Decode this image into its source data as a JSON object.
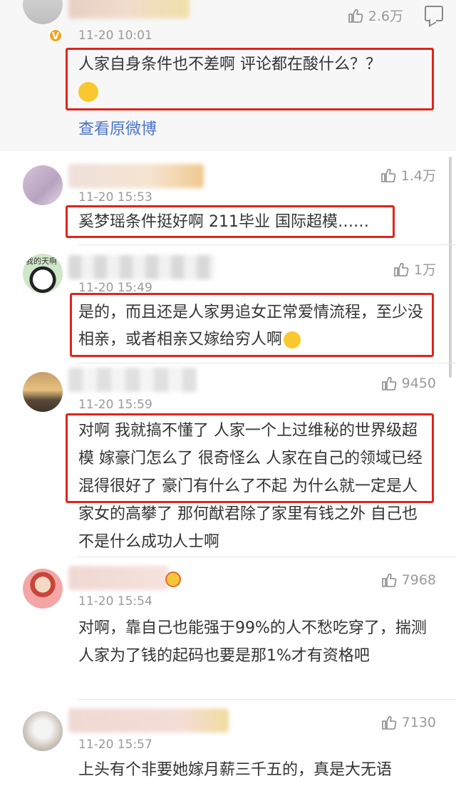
{
  "comments": [
    {
      "time": "11-20 10:01",
      "likes": "2.6万",
      "text": "人家自身条件也不差啊 评论都在酸什么？？",
      "link": "查看原微博"
    },
    {
      "time": "11-20 15:53",
      "likes": "1.4万",
      "text": "奚梦瑶条件挺好啊 211毕业 国际超模……"
    },
    {
      "time": "11-20 15:49",
      "likes": "1万",
      "text": "是的，而且还是人家男追女正常爱情流程，至少没相亲，或者相亲又嫁给穷人啊",
      "avatar_text": "我的天啊"
    },
    {
      "time": "11-20 15:59",
      "likes": "9450",
      "text": "对啊 我就搞不懂了 人家一个上过维秘的世界级超模 嫁豪门怎么了 很奇怪么 人家在自己的领域已经混得很好了 豪门有什么了不起 为什么就一定是人家女的高攀了 那何猷君除了家里有钱之外 自己也不是什么成功人士啊"
    },
    {
      "time": "11-20 15:54",
      "likes": "7968",
      "text": "对啊，靠自己也能强于99%的人不愁吃穿了，揣测人家为了钱的起码也要是那1%才有资格吧"
    },
    {
      "time": "11-20 15:57",
      "likes": "7130",
      "text": "上头有个非要她嫁月薪三千五的，真是大无语"
    }
  ],
  "colors": {
    "highlight_box": "#e0241b",
    "link": "#4a74c9",
    "meta": "#9a9a9a"
  },
  "icons": {
    "like": "thumbs-up-icon",
    "reply": "comment-icon",
    "verified": "v-badge-icon"
  }
}
